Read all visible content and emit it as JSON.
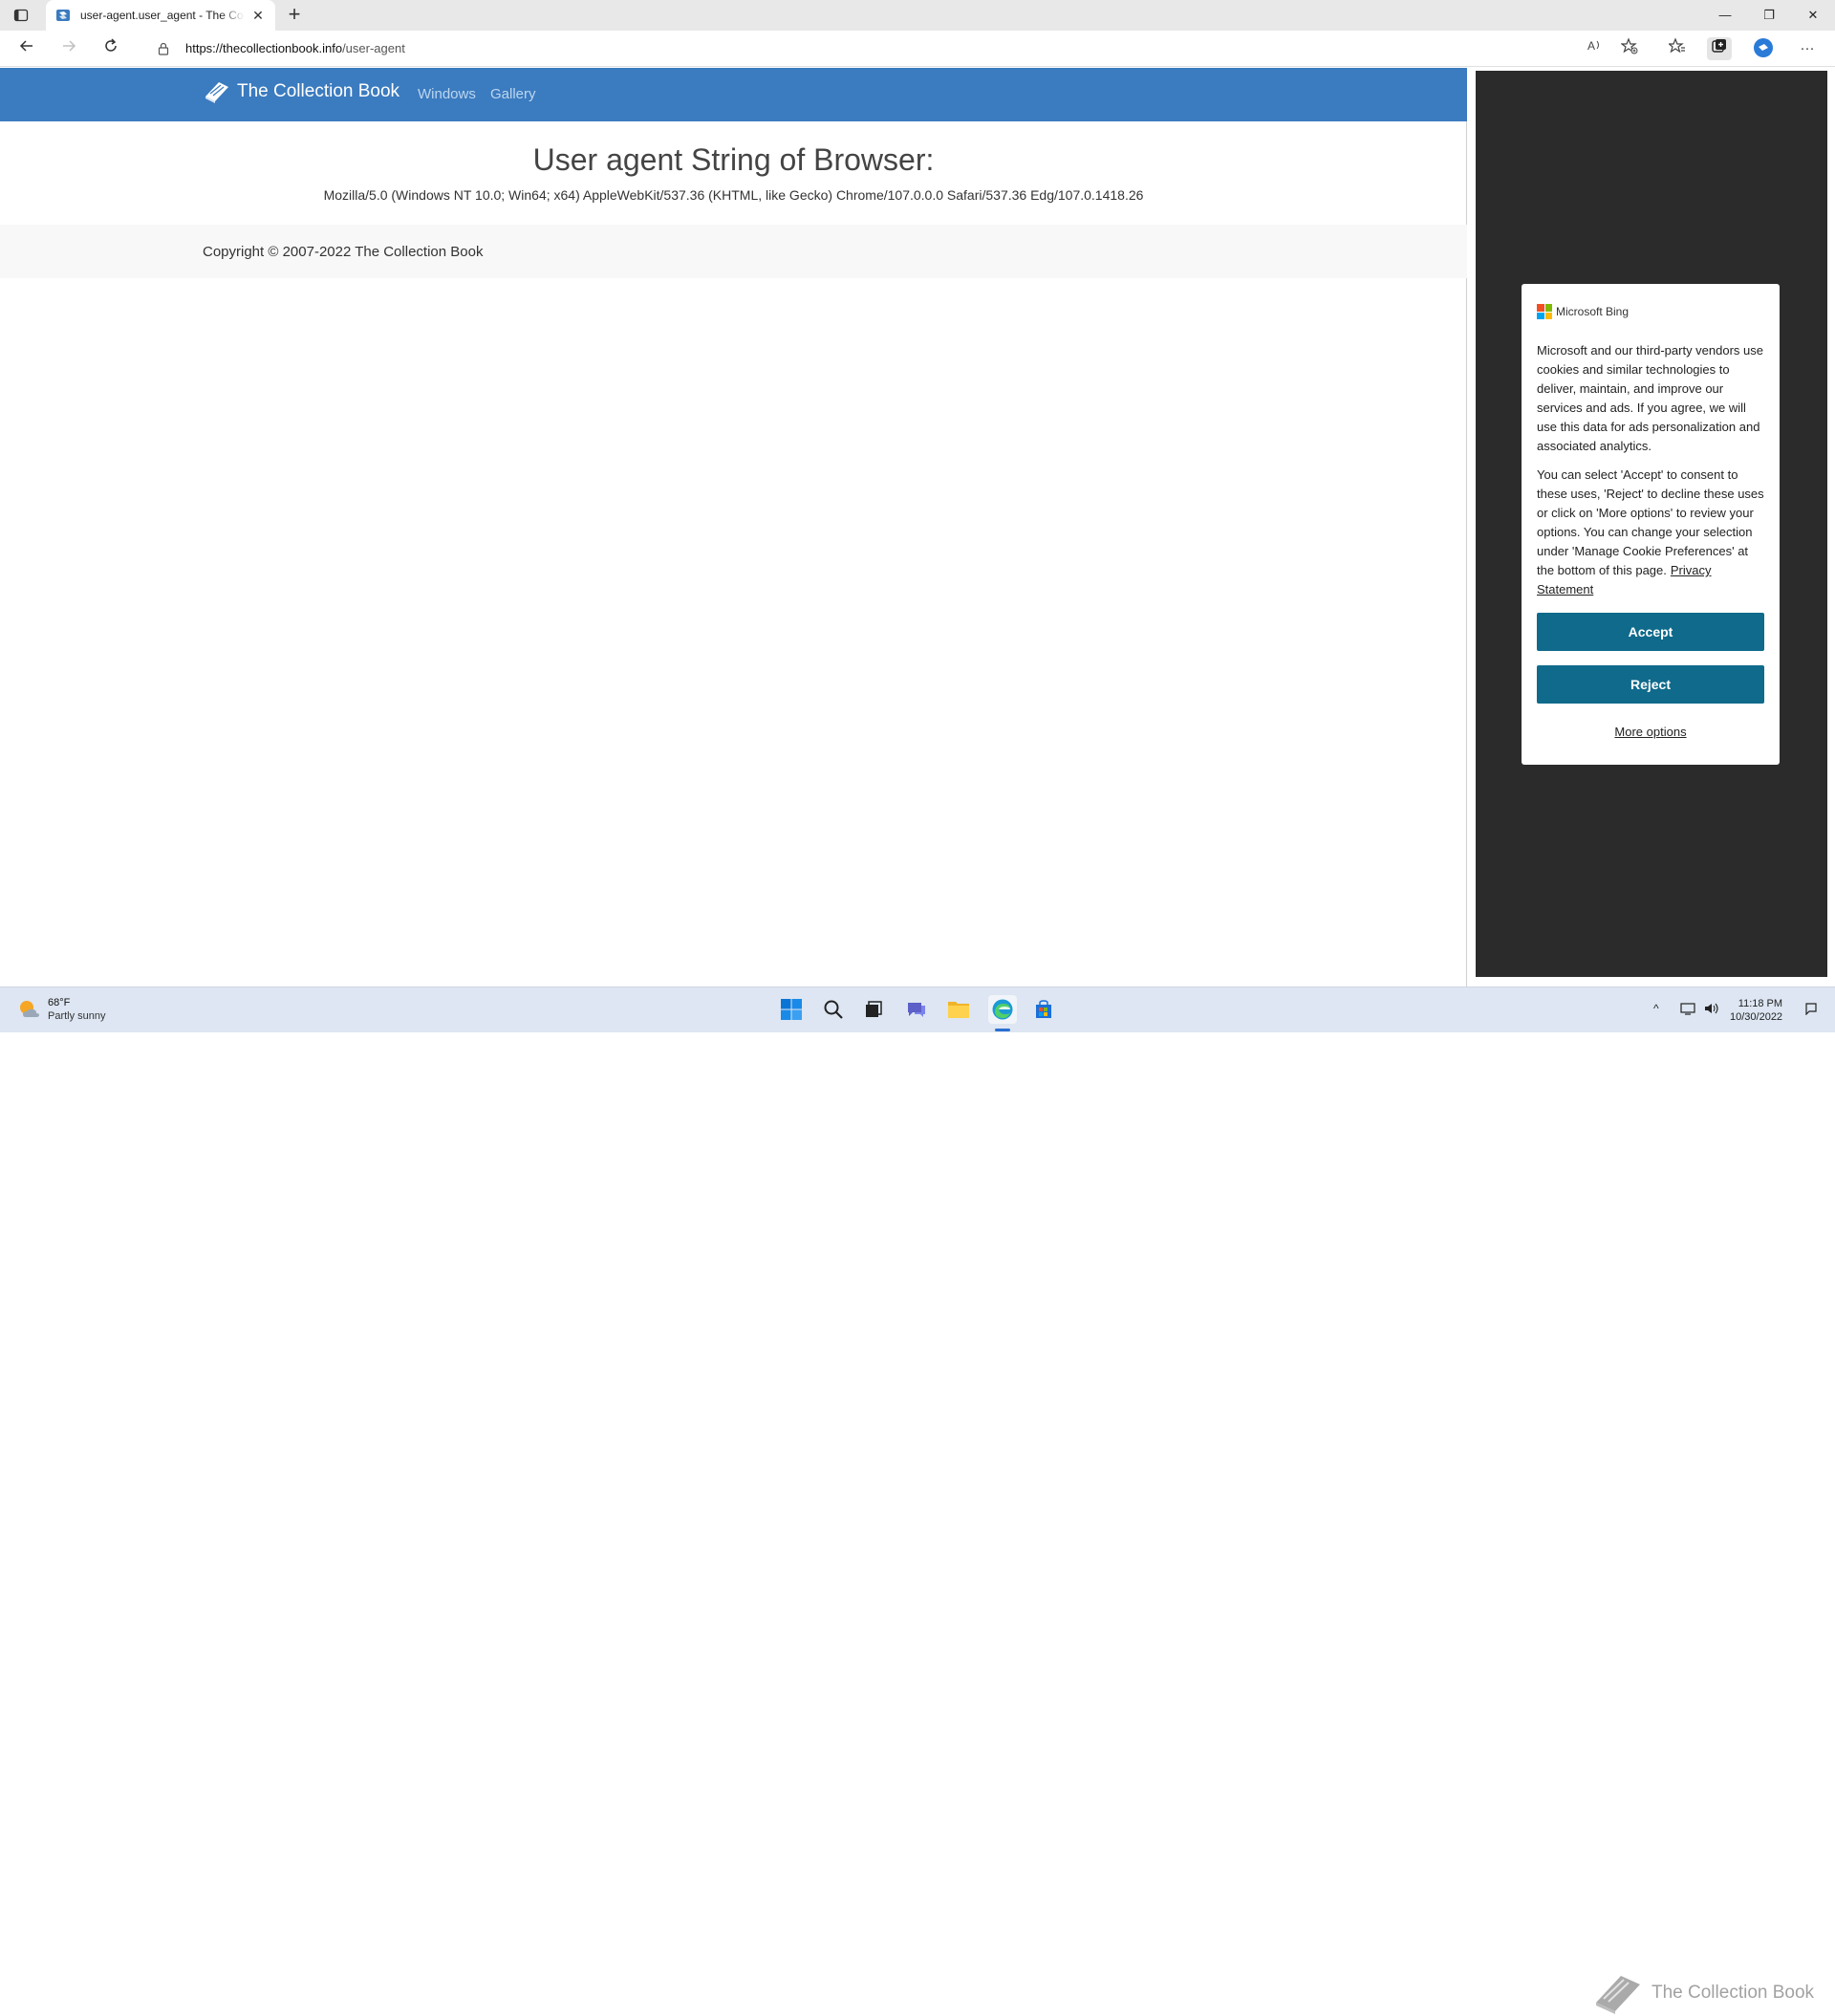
{
  "browser": {
    "tab_title": "user-agent.user_agent - The Collection Book",
    "tab_close_glyph": "✕",
    "new_tab_glyph": "+",
    "url_domain": "https://thecollectionbook.info",
    "url_path": "/user-agent",
    "window_controls": {
      "minimize": "—",
      "restore": "❐",
      "close": "✕"
    },
    "more_glyph": "···"
  },
  "site": {
    "brand": "The Collection Book",
    "nav": [
      "Windows",
      "Gallery"
    ],
    "heading": "User agent String of Browser:",
    "user_agent": "Mozilla/5.0 (Windows NT 10.0; Win64; x64) AppleWebKit/537.36 (KHTML, like Gecko) Chrome/107.0.0.0 Safari/537.36 Edg/107.0.1418.26",
    "copyright": "Copyright © 2007-2022 The Collection Book"
  },
  "cookie": {
    "brand": "Microsoft Bing",
    "para1": "Microsoft and our third-party vendors use cookies and similar technologies to deliver, maintain, and improve our services and ads. If you agree, we will use this data for ads personalization and associated analytics.",
    "para2": "You can select 'Accept' to consent to these uses, 'Reject' to decline these uses or click on 'More options' to review your options. You can change your selection under 'Manage Cookie Preferences' at the bottom of this page.",
    "privacy_link": "Privacy Statement",
    "accept": "Accept",
    "reject": "Reject",
    "more_options": "More options",
    "button_color": "#0f6a8b"
  },
  "taskbar": {
    "temperature": "68°F",
    "condition": "Partly sunny",
    "time": "11:18 PM",
    "date": "10/30/2022",
    "watermark": "The Collection Book"
  },
  "colors": {
    "site_nav": "#3b7bbf",
    "sidebar_bg": "#2b2b2b",
    "taskbar_bg": "#dde6f2"
  }
}
